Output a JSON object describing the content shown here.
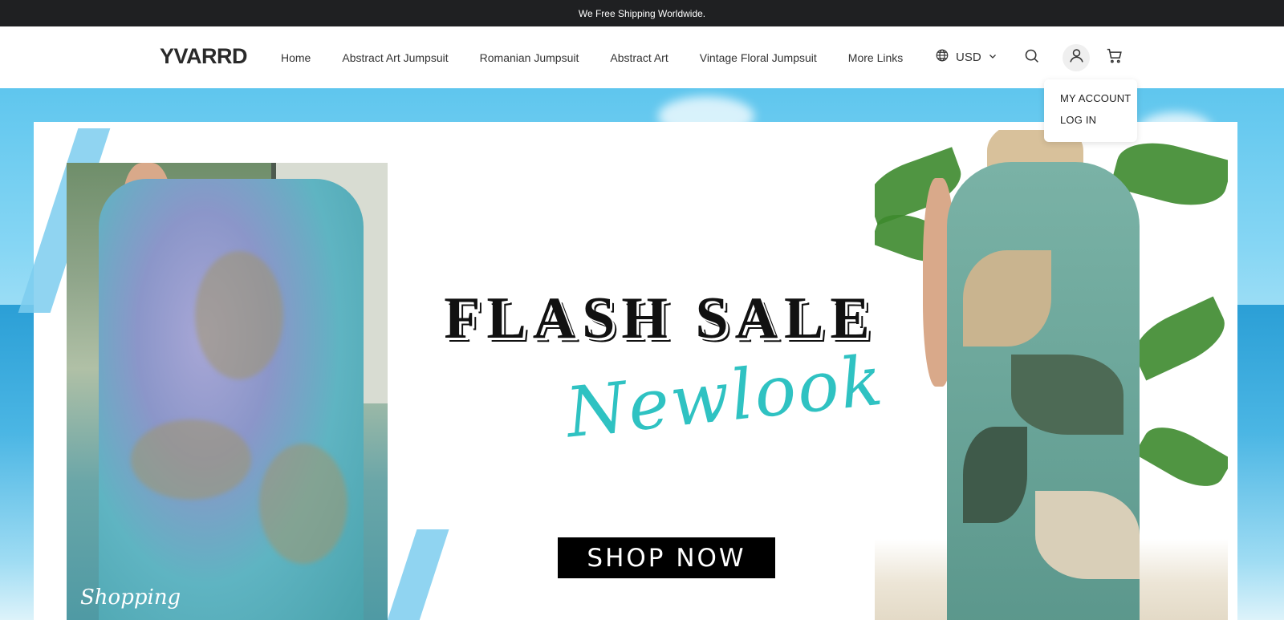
{
  "announcement": "We Free Shipping Worldwide.",
  "header": {
    "logo": "YVARRD",
    "nav": [
      "Home",
      "Abstract Art Jumpsuit",
      "Romanian Jumpsuit",
      "Abstract Art",
      "Vintage Floral Jumpsuit",
      "More Links"
    ],
    "currency": "USD",
    "icons": [
      "globe-icon",
      "chevron-down-icon",
      "search-icon",
      "user-icon",
      "cart-icon"
    ]
  },
  "account_menu": {
    "my_account": "MY ACCOUNT",
    "login": "LOG IN"
  },
  "hero": {
    "headline": "FLASH SALE",
    "script": "Newlook",
    "cta": "SHOP NOW",
    "tag": "Shopping"
  },
  "colors": {
    "announce_bg": "#1f2022",
    "accent_teal": "#2fc2c2",
    "button_bg": "#000000"
  }
}
